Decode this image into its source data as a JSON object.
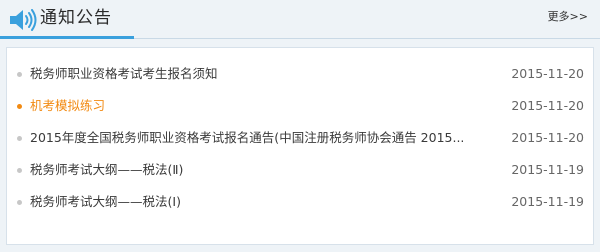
{
  "header": {
    "title": "通知公告",
    "more_label": "更多>>"
  },
  "notices": [
    {
      "title": "税务师职业资格考试考生报名须知",
      "date": "2015-11-20",
      "highlighted": false
    },
    {
      "title": "机考模拟练习",
      "date": "2015-11-20",
      "highlighted": true
    },
    {
      "title": "2015年度全国税务师职业资格考试报名通告(中国注册税务师协会通告 2015...",
      "date": "2015-11-20",
      "highlighted": false
    },
    {
      "title": "税务师考试大纲——税法(Ⅱ)",
      "date": "2015-11-19",
      "highlighted": false
    },
    {
      "title": "税务师考试大纲——税法(Ⅰ)",
      "date": "2015-11-19",
      "highlighted": false
    }
  ],
  "colors": {
    "accent": "#3aa0dd",
    "highlight": "#f28a12"
  },
  "icons": {
    "header": "speaker-icon",
    "bullet": "bullet-dot-icon"
  }
}
